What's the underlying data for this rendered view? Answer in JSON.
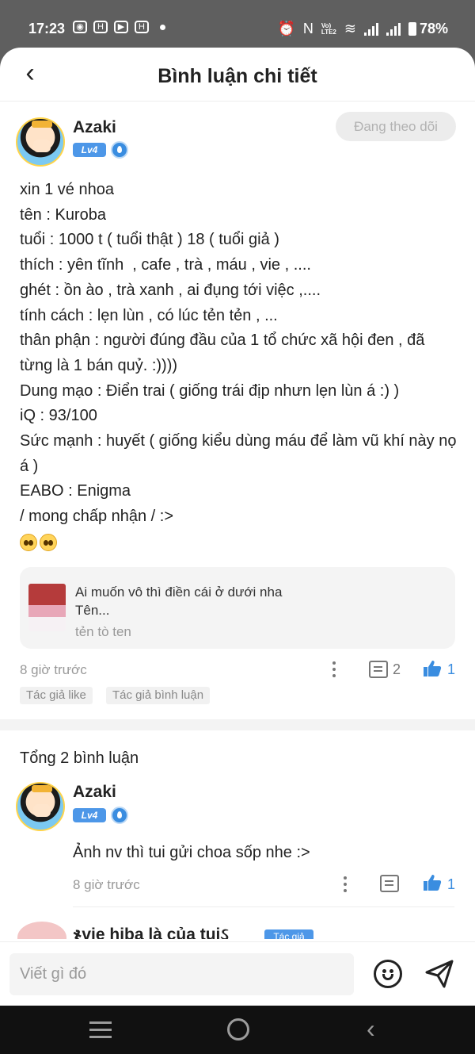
{
  "status_bar": {
    "time": "17:23",
    "battery": "78%",
    "network_label": "VoLTE2"
  },
  "header": {
    "title": "Bình luận chi tiết"
  },
  "post": {
    "author": "Azaki",
    "level": "Lv4",
    "follow_label": "Đang theo dõi",
    "lines": [
      "xin 1 vé nhoa",
      "tên : Kuroba",
      "tuổi : 1000 t ( tuổi thật ) 18 ( tuổi giả )",
      "thích : yên tĩnh  , cafe , trà , máu , vie , ....",
      "ghét : ồn ào , trà xanh , ai đụng tới việc ,....",
      "tính cách : lẹn lùn , có lúc tẻn tẻn , ...",
      "thân phận : người đúng đầu của 1 tổ chức xã hội đen , đã từng là 1 bán quỷ. :))))",
      "Dung mạo : Điển trai ( giống trái địp nhưn lẹn lùn á :) )",
      "iQ : 93/100",
      "Sức mạnh : huyết ( giống kiểu dùng máu để làm vũ khí này nọ á )",
      "EABO : Enigma",
      "/ mong chấp nhận / :>"
    ],
    "quote": {
      "line1": "Ai muốn vô thì điền cái ở dưới nha",
      "line2": "Tên...",
      "author": "tẻn tò ten"
    },
    "time": "8 giờ trước",
    "comment_count": "2",
    "like_count": "1",
    "tags": [
      "Tác giả like",
      "Tác giả bình luận"
    ]
  },
  "comments": {
    "total_label": "Tổng 2 bình luận",
    "items": [
      {
        "author": "Azaki",
        "level": "Lv4",
        "text": "Ảnh nv thì tui gửi choa sốp nhe :>",
        "time": "8 giờ trước",
        "like_count": "1"
      },
      {
        "author": "ჯvie hiba là của tuiઽ",
        "author_tag": "Tác giả"
      }
    ]
  },
  "composer": {
    "placeholder": "Viết gì đó"
  },
  "colors": {
    "accent": "#4d97e8",
    "like": "#3a8de0",
    "muted": "#999999"
  }
}
